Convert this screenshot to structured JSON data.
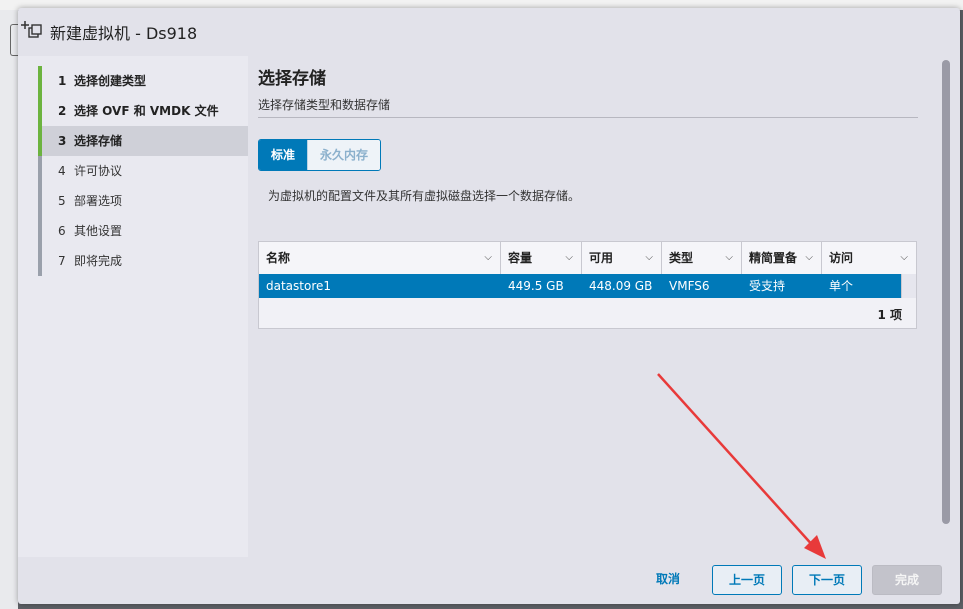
{
  "dialog": {
    "title": "新建虚拟机 - Ds918"
  },
  "steps": [
    {
      "num": "1",
      "label": "选择创建类型"
    },
    {
      "num": "2",
      "label": "选择 OVF 和 VMDK 文件"
    },
    {
      "num": "3",
      "label": "选择存储"
    },
    {
      "num": "4",
      "label": "许可协议"
    },
    {
      "num": "5",
      "label": "部署选项"
    },
    {
      "num": "6",
      "label": "其他设置"
    },
    {
      "num": "7",
      "label": "即将完成"
    }
  ],
  "main": {
    "title": "选择存储",
    "subtitle": "选择存储类型和数据存储",
    "tabs": [
      "标准",
      "永久内存"
    ],
    "description": "为虚拟机的配置文件及其所有虚拟磁盘选择一个数据存储。"
  },
  "grid": {
    "columns": [
      "名称",
      "容量",
      "可用",
      "类型",
      "精简置备",
      "访问"
    ],
    "rows": [
      [
        "datastore1",
        "449.5 GB",
        "448.09 GB",
        "VMFS6",
        "受支持",
        "单个"
      ]
    ],
    "footer": "1 项"
  },
  "footer": {
    "cancel": "取消",
    "prev": "上一页",
    "next": "下一页",
    "finish": "完成"
  },
  "colors": {
    "accent": "#0079b8",
    "step_done": "#6cb33f",
    "annotation_arrow": "#e83a3a"
  }
}
